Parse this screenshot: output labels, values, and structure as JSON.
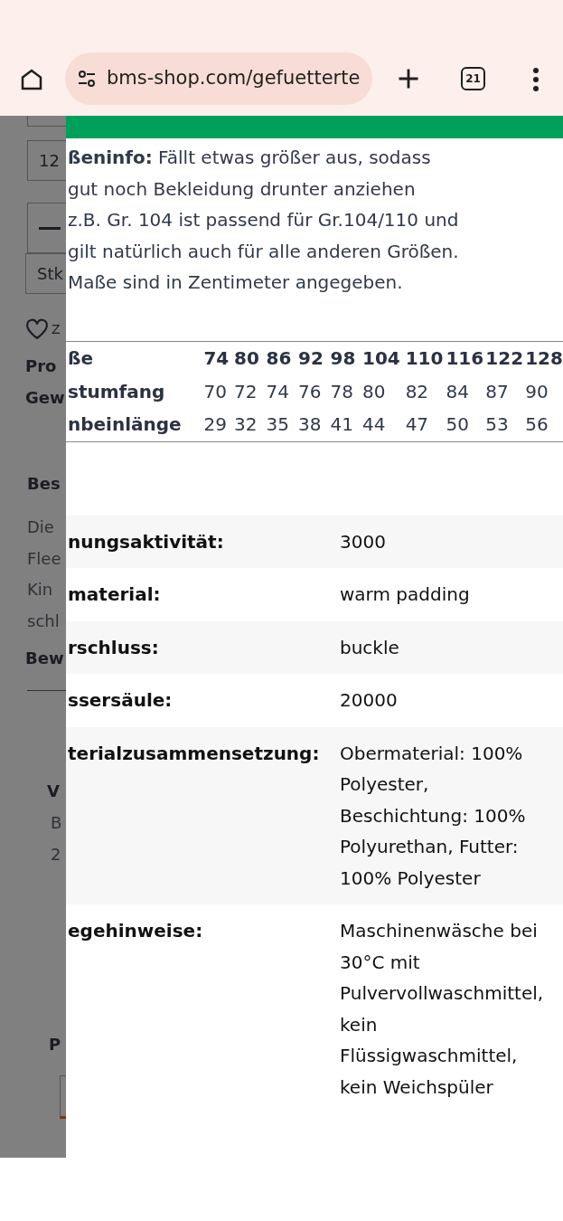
{
  "browser": {
    "url": "bms-shop.com/gefuetterte",
    "tab_count": "21"
  },
  "background_page": {
    "quantity_value": "12",
    "unit_value": "Stk",
    "wishlist_label": "Z",
    "product_labels": [
      "Pro",
      "Gew"
    ],
    "description_heading": "Bes",
    "description_lines": [
      "Die",
      "Flee",
      "Kin",
      "schl"
    ],
    "reviews_heading": "Bew",
    "vendor_title": "V",
    "vendor_lines": [
      "B",
      "2"
    ],
    "section_heading": "P"
  },
  "size_panel": {
    "note_lines": [
      "**ßeninfo:** Fällt etwas größer aus, sodass",
      "gut noch Bekleidung drunter anziehen",
      "z.B. Gr. 104 ist passend für Gr.104/110 und",
      "gilt natürlich auch für alle anderen Größen.",
      "Maße sind in Zentimeter angegeben."
    ],
    "size_table": {
      "header": {
        "label": "ße",
        "values": [
          "74",
          "80",
          "86",
          "92",
          "98",
          "104",
          "110",
          "116",
          "122",
          "128"
        ]
      },
      "rows": [
        {
          "label": "stumfang",
          "values": [
            "70",
            "72",
            "74",
            "76",
            "78",
            "80",
            "82",
            "84",
            "87",
            "90"
          ]
        },
        {
          "label": "nbeinlänge",
          "values": [
            "29",
            "32",
            "35",
            "38",
            "41",
            "44",
            "47",
            "50",
            "53",
            "56"
          ]
        }
      ]
    },
    "specs": [
      {
        "label": "nungsaktivität:",
        "value_lines": [
          "3000"
        ]
      },
      {
        "label": "material:",
        "value_lines": [
          "warm padding"
        ]
      },
      {
        "label": "rschluss:",
        "value_lines": [
          "buckle"
        ]
      },
      {
        "label": "ssersäule:",
        "value_lines": [
          "20000"
        ]
      },
      {
        "label": "terialzusammensetzung:",
        "value_lines": [
          "Obermaterial: 100%",
          "Polyester,",
          "Beschichtung: 100%",
          "Polyurethan, Futter:",
          "100% Polyester"
        ]
      },
      {
        "label": "egehinweise:",
        "value_lines": [
          "Maschinenwäsche bei",
          "30°C mit",
          "Pulvervollwaschmittel,",
          "kein",
          "Flüssigwaschmittel,",
          "kein Weichspüler"
        ]
      }
    ]
  }
}
